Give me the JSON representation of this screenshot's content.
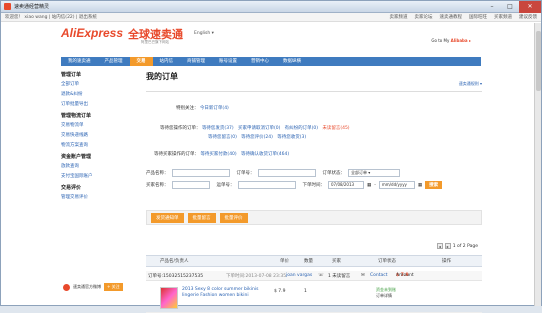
{
  "window": {
    "title": "速卖通经营精灵"
  },
  "topbar": {
    "welcome": "欢迎您！ xiao wang | 站内信(22) | 退出系统",
    "links": [
      "卖家频道",
      "卖家论坛",
      "速卖通教程",
      "国际旺旺",
      "买家频道",
      "建议反馈"
    ]
  },
  "header": {
    "logo": "AliExpress",
    "logo_cn": "全球速卖通",
    "tagline": "阿里巴巴旗下网站",
    "language": "English ▾",
    "goto": "Go to My",
    "goto_brand": "Alibaba ▸"
  },
  "nav": {
    "items": [
      "我的速卖通",
      "产品管理",
      "交易",
      "站内信",
      "商铺管理",
      "账号设置",
      "营销中心",
      "数据纵横"
    ],
    "active_index": 2
  },
  "sidebar": {
    "groups": [
      {
        "title": "管理订单",
        "items": [
          "全部订单",
          "退款&纠纷",
          "订单批量导出"
        ]
      },
      {
        "title": "管理物流订单",
        "items": [
          "交易物流单",
          "交易快递线路",
          "物流方案查询"
        ]
      },
      {
        "title": "资金账户管理",
        "items": [
          "放款查询",
          "支付宝国际账户"
        ]
      },
      {
        "title": "交易评价",
        "items": [
          "管理交易评价"
        ]
      }
    ],
    "weibo_label": "速卖通官方微博",
    "follow_label": "+ 关注"
  },
  "main": {
    "title": "我的订单",
    "track_link": "速卖通规则 ▾",
    "special_attention_label": "特别关注：",
    "special_attention_link": "今日新订单(4)",
    "wait_me_label": "等待您操作的订单：",
    "wait_me_links": [
      "等待您发货(37)",
      "买家申请取消订单(0)",
      "有纠纷的订单(0)",
      "未读留言(45)",
      "等待您留言(0)",
      "等待您评价(24)",
      "等待您收货(3)"
    ],
    "wait_buyer_label": "等待买家操作的订单：",
    "wait_buyer_links": [
      "等待买家付款(40)",
      "等待确认收货订单(464)"
    ],
    "filters": {
      "product_name_label": "产品名称：",
      "order_no_label": "订单号：",
      "order_status_label": "订单状态：",
      "order_status_value": "全部订单",
      "buyer_name_label": "买家名称：",
      "tracking_no_label": "运单号：",
      "order_time_label": "下单时间：",
      "date_from": "07/08/2013",
      "date_to": "mm/dd/yyyy",
      "search_button": "搜索"
    },
    "actions": [
      "发货通知单",
      "批量留言",
      "批量评价"
    ],
    "pager": {
      "text": "1 of 2 Page"
    },
    "table": {
      "headers": [
        "产品名/负责人",
        "单价",
        "数量",
        "买家",
        "订单状态",
        "操作"
      ],
      "orders": [
        {
          "order_id": "订单号:1503251523753​5",
          "time": "下单时间:2013-07-08 23:35",
          "buyer": "joan vargas",
          "message": "1 未读留言",
          "contact": "Contact",
          "amount_label": "Amount",
          "amount": "$ 7.9",
          "product_name": "2013 Sexy 8 color summer bikinis lingerie Fashion women bikini",
          "price": "$ 7.9",
          "quantity": "1",
          "status_lines": [
            "资金未到账",
            "订单详情"
          ]
        }
      ]
    }
  }
}
